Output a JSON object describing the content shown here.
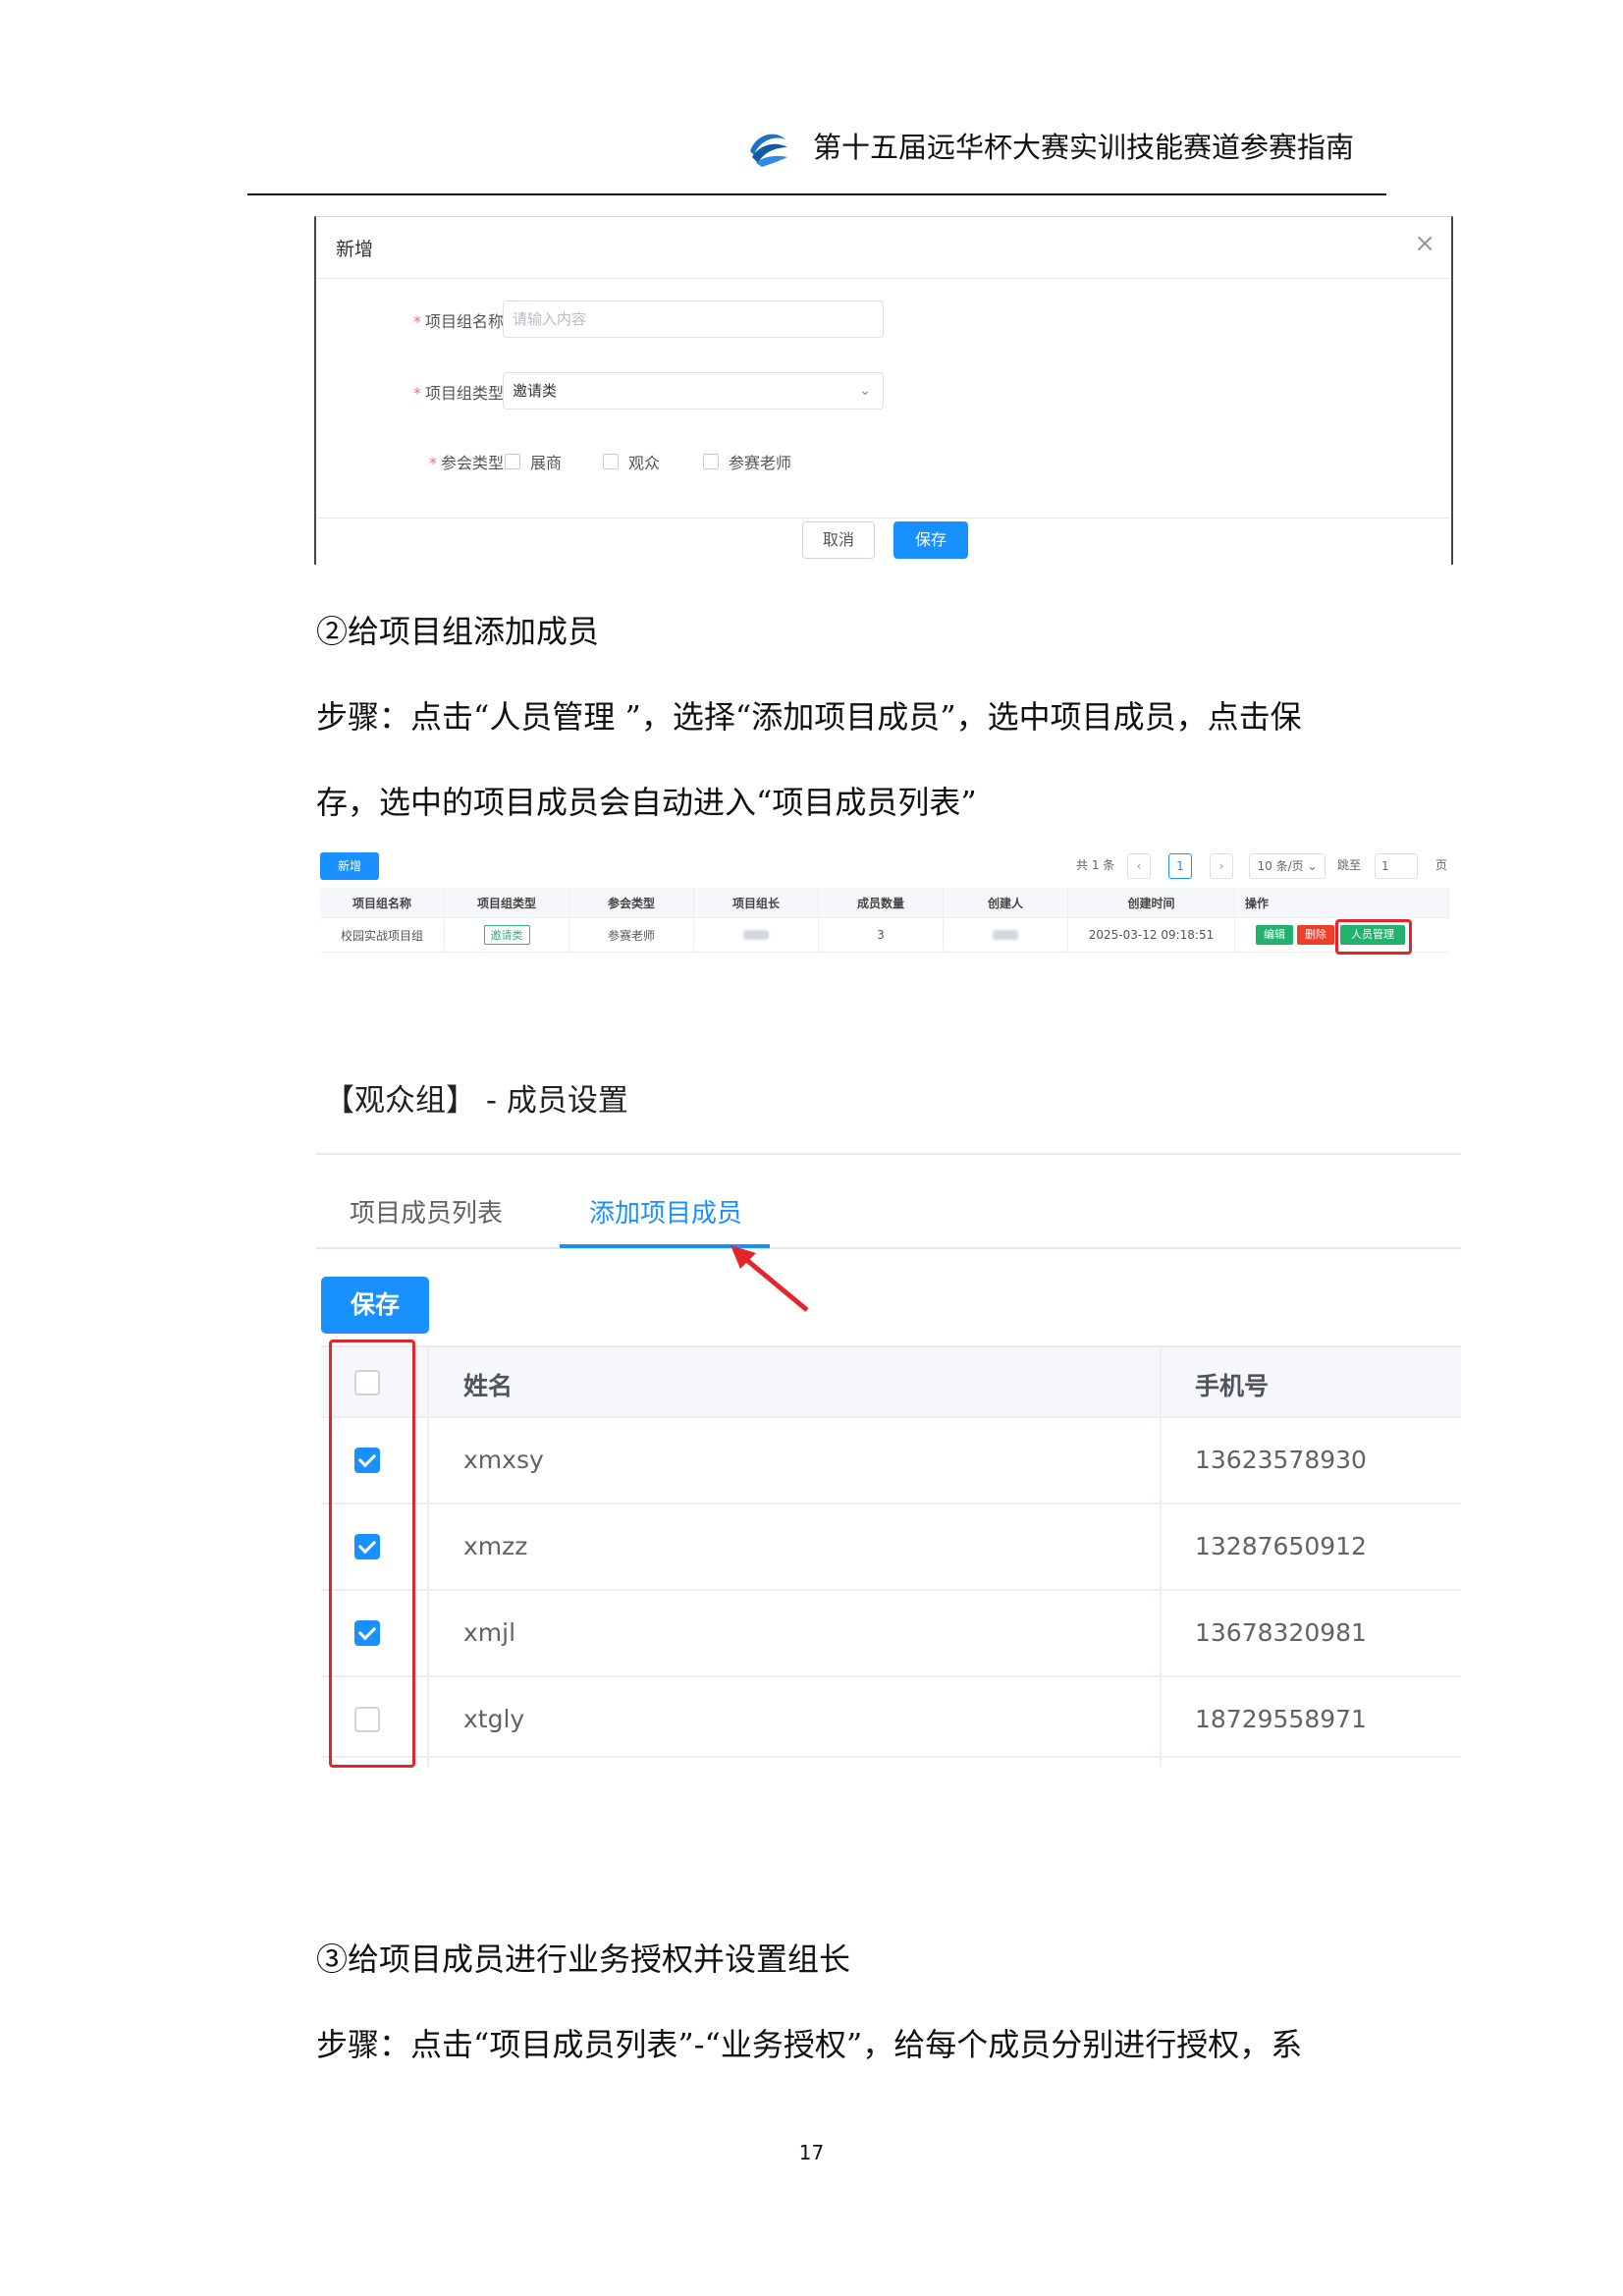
{
  "header": {
    "title": "第十五届远华杯大赛实训技能赛道参赛指南"
  },
  "dialog": {
    "title": "新增",
    "close": "×",
    "field_name": {
      "label": "项目组名称",
      "placeholder": "请输入内容"
    },
    "field_type": {
      "label": "项目组类型",
      "value": "邀请类"
    },
    "field_attend": {
      "label": "参会类型",
      "options": [
        "展商",
        "观众",
        "参赛老师"
      ]
    },
    "cancel": "取消",
    "save": "保存"
  },
  "section2": {
    "heading": "②给项目组添加成员",
    "line1": "步骤：点击“人员管理 ”，选择“添加项目成员”，选中项目成员，点击保",
    "line2": "存，选中的项目成员会自动进入“项目成员列表”"
  },
  "list": {
    "new_button": "新增",
    "pagination": {
      "total": "共 1 条",
      "prev": "‹",
      "page": "1",
      "next": "›",
      "size": "10 条/页 ⌄",
      "jump": "跳至",
      "jump_value": "1",
      "page_unit": "页"
    },
    "headers": [
      "项目组名称",
      "项目组类型",
      "参会类型",
      "项目组长",
      "成员数量",
      "创建人",
      "创建时间",
      "操作"
    ],
    "row": {
      "name": "校园实战项目组",
      "type": "邀请类",
      "attend": "参赛老师",
      "count": "3",
      "created": "2025-03-12 09:18:51"
    },
    "ops": {
      "edit": "编辑",
      "delete": "删除",
      "manage": "人员管理"
    }
  },
  "member_settings": {
    "title": "【观众组】 - 成员设置",
    "tabs": [
      "项目成员列表",
      "添加项目成员"
    ],
    "save": "保存",
    "columns": {
      "name": "姓名",
      "phone": "手机号"
    },
    "rows": [
      {
        "name": "xmxsy",
        "phone": "13623578930",
        "checked": true
      },
      {
        "name": "xmzz",
        "phone": "13287650912",
        "checked": true
      },
      {
        "name": "xmjl",
        "phone": "13678320981",
        "checked": true
      },
      {
        "name": "xtgly",
        "phone": "18729558971",
        "checked": false
      }
    ]
  },
  "section3": {
    "heading": "③给项目成员进行业务授权并设置组长",
    "line1": "步骤：点击“项目成员列表”-“业务授权”，给每个成员分别进行授权，系"
  },
  "page_number": "17",
  "colors": {
    "primary": "#1890ff",
    "danger": "#e4262b",
    "success": "#30b07a"
  }
}
